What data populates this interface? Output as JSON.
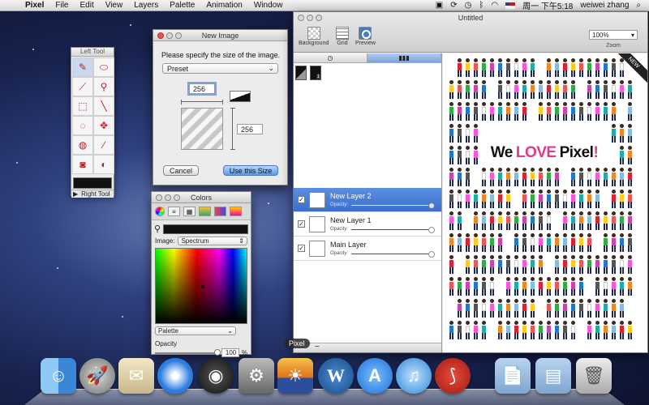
{
  "menubar": {
    "apple": "",
    "app_name": "Pixel",
    "menus": [
      "File",
      "Edit",
      "View",
      "Layers",
      "Palette",
      "Animation",
      "Window"
    ],
    "clock": "周一 下午5:18",
    "user": "weiwei zhang"
  },
  "left_tool": {
    "title": "Left Tool",
    "right_tool_label": "Right Tool",
    "tools": [
      "pencil-icon",
      "eraser-icon",
      "brush-icon",
      "magic-wand-icon",
      "select-rect-icon",
      "line-icon",
      "lasso-icon",
      "move-icon",
      "fill-bucket-icon",
      "eyedropper-icon",
      "spray-icon",
      "stamp-icon"
    ]
  },
  "new_image": {
    "title": "New Image",
    "prompt": "Please specify the size of the image.",
    "preset": "Preset",
    "width": "256",
    "height": "256",
    "cancel": "Cancel",
    "ok": "Use this Size"
  },
  "colors": {
    "title": "Colors",
    "image_label": "Image:",
    "image_value": "Spectrum",
    "palette": "Palette",
    "opacity_label": "Opacity",
    "opacity_value": "100",
    "percent": "%"
  },
  "main_window": {
    "title": "Untitled",
    "toolbar": {
      "background": "Background",
      "grid": "Grid",
      "preview": "Preview"
    },
    "zoom_value": "100%",
    "zoom_label": "Zoom"
  },
  "layers": [
    {
      "name": "New Layer 2",
      "opacity_label": "Opacity:",
      "selected": true
    },
    {
      "name": "New Layer 1",
      "opacity_label": "Opacity:",
      "selected": false
    },
    {
      "name": "Main Layer",
      "opacity_label": "Opacity:",
      "selected": false
    }
  ],
  "canvas": {
    "we": "We",
    "love": "LOVE",
    "pixel": "Pixel",
    "bang": "!",
    "ribbon": "NEW"
  },
  "dock": {
    "tooltip": "Pixel",
    "items": [
      "finder-icon",
      "launchpad-icon",
      "preview-icon",
      "safari-icon",
      "dashboard-icon",
      "system-preferences-icon",
      "pixel-app-icon",
      "wordpress-icon",
      "app-store-icon",
      "itunes-icon",
      "acrobat-icon",
      "documents-folder-icon",
      "applications-folder-icon",
      "trash-icon"
    ]
  }
}
